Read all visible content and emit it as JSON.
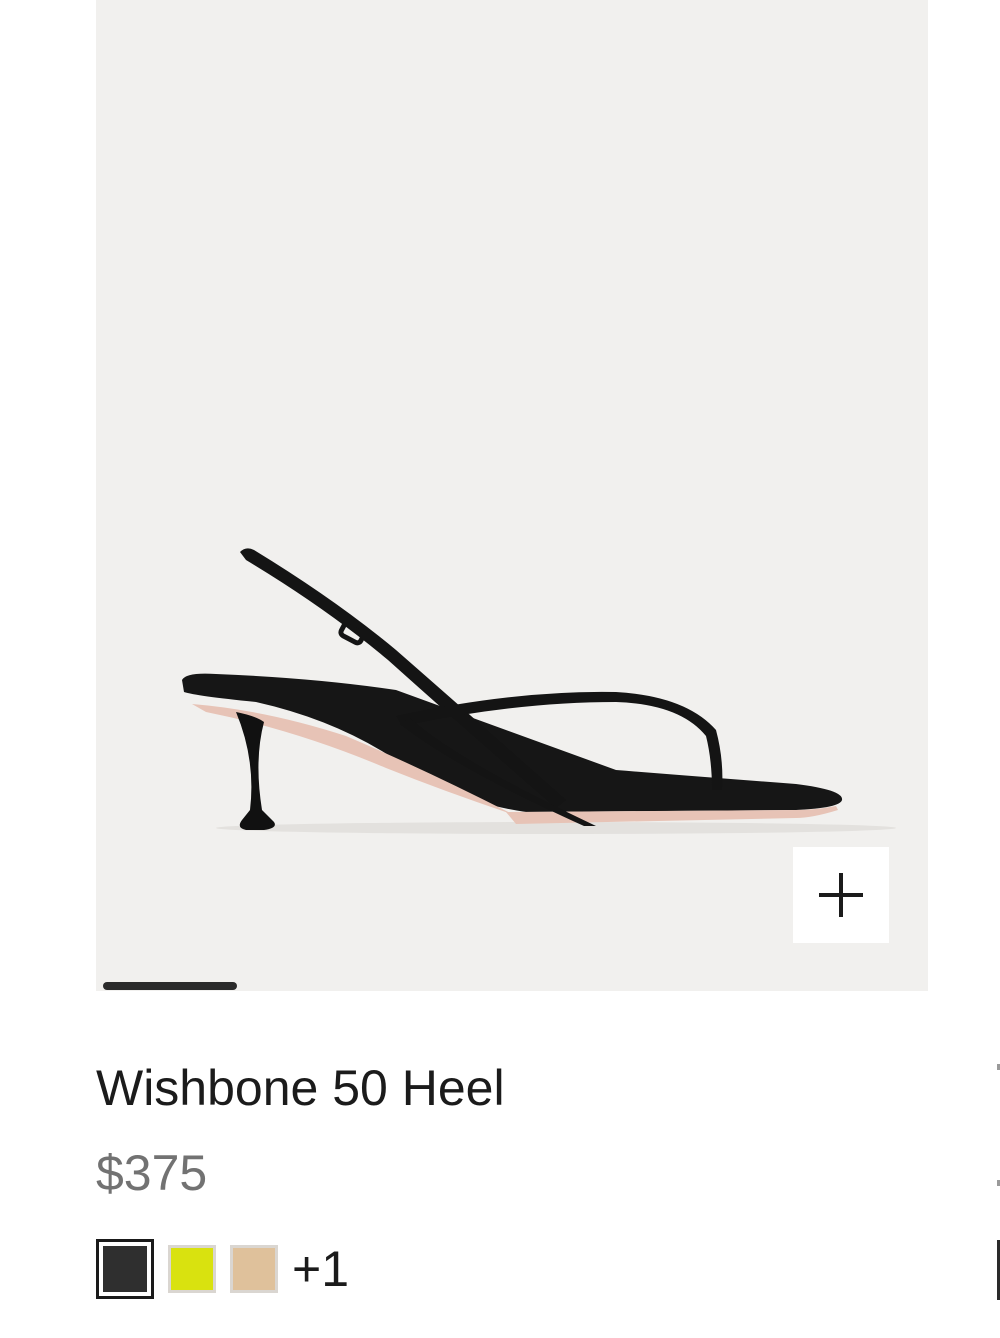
{
  "product": {
    "title": "Wishbone 50 Heel",
    "price": "$375",
    "image_alt": "black thong sandal with slingback strap and kitten heel",
    "zoom_icon": "plus-icon",
    "carousel_progress": 0.164,
    "colors": {
      "image_background": "#f1f0ee",
      "title": "#1b1b1b",
      "price": "#727272",
      "progress": "#2b2b2b"
    },
    "swatches": [
      {
        "name": "Black",
        "color": "#2f2f2f",
        "selected": true
      },
      {
        "name": "Yellow",
        "color": "#d9e20f",
        "selected": false
      },
      {
        "name": "Tan",
        "color": "#dfc19b",
        "selected": false
      }
    ],
    "more_swatches": "+1"
  }
}
